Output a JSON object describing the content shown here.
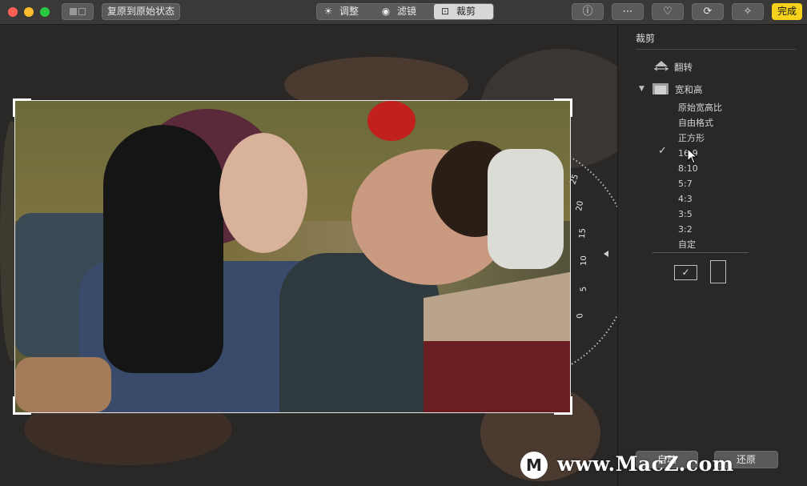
{
  "toolbar": {
    "revert_label": "复原到原始状态",
    "tabs": [
      {
        "label": "调整",
        "icon": "adjust-dial-icon"
      },
      {
        "label": "滤镜",
        "icon": "filter-circles-icon"
      },
      {
        "label": "裁剪",
        "icon": "crop-icon",
        "selected": true
      }
    ],
    "right_buttons": [
      {
        "icon": "info-icon",
        "glyph": "ⓘ"
      },
      {
        "icon": "more-options-icon",
        "glyph": "⋯"
      },
      {
        "icon": "heart-icon",
        "glyph": "♡"
      },
      {
        "icon": "rotate-icon",
        "glyph": "⟳"
      },
      {
        "icon": "magic-wand-icon",
        "glyph": "✧"
      }
    ],
    "done_label": "完成",
    "accent_color": "#f6d21d"
  },
  "rotation_dial": {
    "ticks": [
      "25",
      "20",
      "15",
      "10",
      "5",
      "0"
    ]
  },
  "sidebar": {
    "title": "裁剪",
    "flip_label": "翻转",
    "aspect_label": "宽和高",
    "ratios": [
      "原始宽高比",
      "自由格式",
      "正方形",
      "16:9",
      "8:10",
      "5:7",
      "4:3",
      "3:5",
      "3:2",
      "自定"
    ],
    "selected_ratio": "16:9",
    "auto_label": "自动",
    "reset_label": "还原"
  },
  "watermark": {
    "logo_letter": "M",
    "text": "www.MacZ.com"
  }
}
